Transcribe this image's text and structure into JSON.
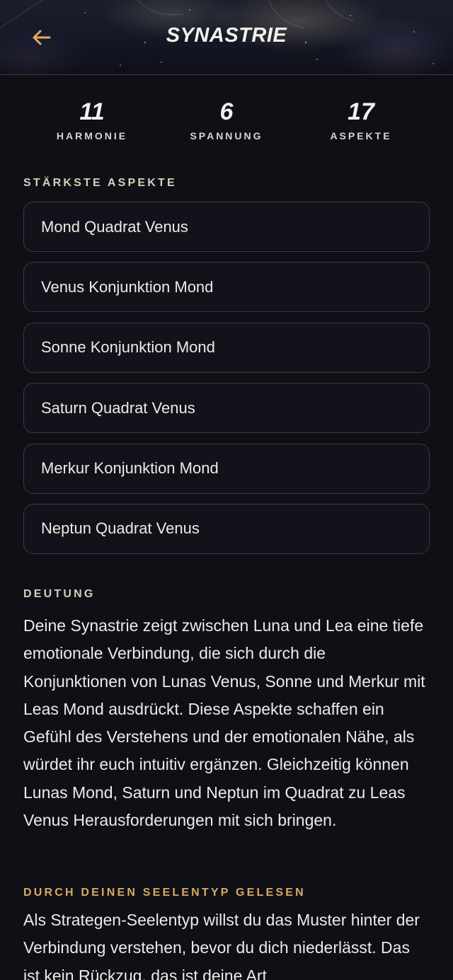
{
  "header": {
    "title": "SYNASTRIE"
  },
  "stats": [
    {
      "value": "11",
      "label": "HARMONIE"
    },
    {
      "value": "6",
      "label": "SPANNUNG"
    },
    {
      "value": "17",
      "label": "ASPEKTE"
    }
  ],
  "aspects": {
    "heading": "STÄRKSTE ASPEKTE",
    "items": [
      "Mond Quadrat Venus",
      "Venus Konjunktion Mond",
      "Sonne Konjunktion Mond",
      "Saturn Quadrat Venus",
      "Merkur Konjunktion Mond",
      "Neptun Quadrat Venus"
    ]
  },
  "deutung": {
    "heading": "DEUTUNG",
    "text": "Deine Synastrie zeigt zwischen Luna und Lea eine tiefe emotionale Verbindung, die sich durch die Konjunktionen von Lunas Venus, Sonne und Merkur mit Leas Mond ausdrückt. Diese Aspekte schaffen ein Gefühl des Verstehens und der emotionalen Nähe, als würdet ihr euch intuitiv ergänzen. Gleichzeitig können Lunas Mond, Saturn und Neptun im Quadrat zu Leas Venus Herausforderungen mit sich bringen."
  },
  "seelentyp": {
    "heading": "DURCH DEINEN SEELENTYP GELESEN",
    "text": "Als Strategen-Seelentyp willst du das Muster hinter der Verbindung verstehen, bevor du dich niederlässt. Das ist kein Rückzug, das ist deine Art"
  },
  "colors": {
    "background": "#0f0f16",
    "accent_gold": "#d9aa63",
    "text": "#ecebe6",
    "card_border": "#3a3a45"
  },
  "icons": {
    "back": "arrow-left-icon"
  }
}
